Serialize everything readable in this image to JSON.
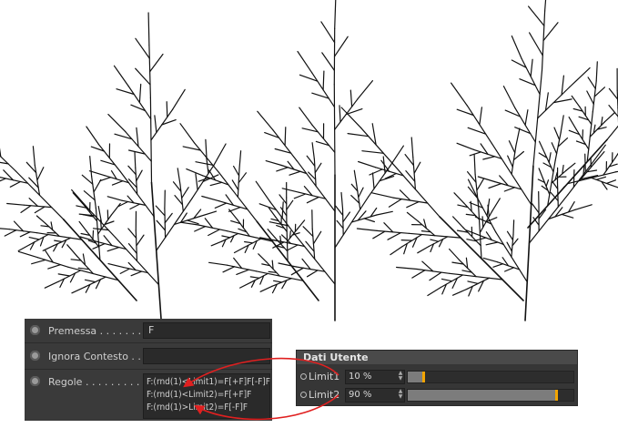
{
  "attribute_panel": {
    "rows": [
      {
        "label": "Premessa . . . . . . . .",
        "value": "F"
      },
      {
        "label": "Ignora Contesto  . .",
        "value": ""
      },
      {
        "label": "Regole  . . . . . . . . . .",
        "value": "F:(rnd(1)<Limit1)=F[+F]F[-F]F\nF:(rnd(1)<Limit2)=F[+F]F\nF:(rnd(1)>Limit2)=F[-F]F"
      }
    ]
  },
  "user_data_panel": {
    "title": "Dati Utente",
    "params": [
      {
        "name": "Limit1",
        "value": "10 %",
        "fraction": 0.1
      },
      {
        "name": "Limit2",
        "value": "90 %",
        "fraction": 0.9
      }
    ]
  },
  "colors": {
    "panel_bg": "#3a3a3a",
    "slider_handle": "#f2a400",
    "annotation_curve": "#e02020",
    "tree_stroke": "#111111"
  },
  "icons": {
    "radio": "radio-button-icon",
    "arrows": "spinner-arrows-icon"
  }
}
